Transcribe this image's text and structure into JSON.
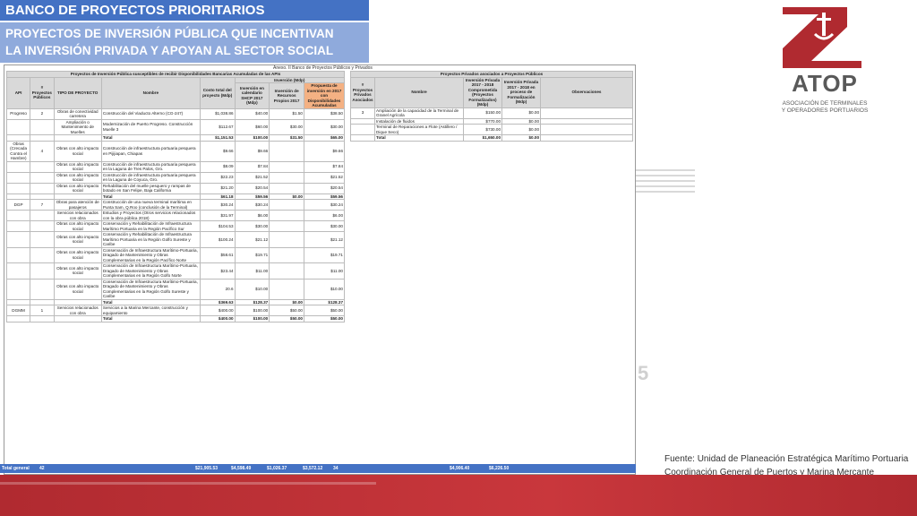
{
  "header": {
    "title": "BANCO DE PROYECTOS PRIORITARIOS",
    "subtitle_line1": "PROYECTOS DE INVERSIÓN PÚBLICA QUE INCENTIVAN",
    "subtitle_line2": "LA INVERSIÓN PRIVADA Y APOYAN AL SECTOR SOCIAL"
  },
  "logo": {
    "brand": "ATOP",
    "sub1": "ASOCIACIÓN DE TERMINALES",
    "sub2": "Y OPERADORES PORTUARIOS",
    "color": "#b02a30"
  },
  "table": {
    "caption": "Anexo. II Banco de Proyectos Públicos y Privados",
    "left_header": "Proyectos de Inversión Pública susceptibles de recibir Disponibilidades Bancarias Acumuladas de las APIs",
    "right_header": "Proyectos Privados asociados a Proyectos Públicos",
    "inversion_header": "Inversión (Mdp)",
    "cols_left": [
      "API",
      "# Proyectos Públicos",
      "TIPO DE PROYECTO",
      "Nombre",
      "Costo total del proyecto (Mdp)",
      "Inversión en calendario SHCP 2017 (Mdp)",
      "Inversión de Recursos Propios 2017",
      "Propuesta de inversión en 2017 con Disponibilidades Acumuladas"
    ],
    "cols_right": [
      "# Proyectos Privados Asociados",
      "Nombre",
      "Inversión Privada 2017 - 2018 Comprometida (Proyectos Formalizados) (Mdp)",
      "Inversión Privada 2017 - 2018 en proceso de Formalización (Mdp)",
      "Observaciones"
    ],
    "rows": [
      {
        "api": "Progreso",
        "n": "2",
        "tipo": "Obras de conectividad carretera",
        "nombre": "Construcción del Viaducto Alterno (CG-247)",
        "costo": "$1,038.86",
        "shcp": "$40.00",
        "propios": "$1.50",
        "prop": "$38.50"
      },
      {
        "api": "",
        "n": "",
        "tipo": "Ampliación o Mantenimiento de Muelles",
        "nombre": "Modernización de Puerto Progreso. Construcción Muelle 3",
        "costo": "$112.67",
        "shcp": "$60.00",
        "propios": "$30.00",
        "prop": "$30.00"
      },
      {
        "api": "",
        "n": "",
        "tipo": "",
        "nombre": "Total",
        "costo": "$1,151.53",
        "shcp": "$100.00",
        "propios": "$31.50",
        "prop": "$65.00",
        "total": true
      },
      {
        "api": "Obras (Crecada Contra el Hambre)",
        "n": "4",
        "tipo": "Obras con alto impacto social",
        "nombre": "Construcción de infraestructura portuaria pesquera en Pijijiapan, Chiapas",
        "costo": "$9.66",
        "shcp": "$9.66",
        "propios": "",
        "prop": "$9.66"
      },
      {
        "api": "",
        "n": "",
        "tipo": "Obras con alto impacto social",
        "nombre": "Construcción de infraestructura portuaria pesquera en la Laguna de Tres Palos, Gro.",
        "costo": "$8.09",
        "shcp": "$7.84",
        "propios": "",
        "prop": "$7.84"
      },
      {
        "api": "",
        "n": "",
        "tipo": "Obras con alto impacto social",
        "nombre": "Construcción de infraestructura portuaria pesquera en la Laguna de Coyuca, Gro.",
        "costo": "$22.23",
        "shcp": "$21.52",
        "propios": "",
        "prop": "$21.52"
      },
      {
        "api": "",
        "n": "",
        "tipo": "Obras con alto impacto social",
        "nombre": "Rehabilitación del muelle pesquero y rampas de botado en San Felipe, Baja California",
        "costo": "$21.20",
        "shcp": "$20.54",
        "propios": "",
        "prop": "$20.54"
      },
      {
        "api": "",
        "n": "",
        "tipo": "",
        "nombre": "Total",
        "costo": "$61.18",
        "shcp": "$59.56",
        "propios": "$0.00",
        "prop": "$59.56",
        "total": true
      },
      {
        "api": "DGP",
        "n": "7",
        "tipo": "Obras para atención de pasajeros",
        "nombre": "Construcción de una nueva terminal marítima en Punta Sam, Q.Roo (conclusión de la Terminal)",
        "costo": "$30.24",
        "shcp": "$30.24",
        "propios": "",
        "prop": "$30.24"
      },
      {
        "api": "",
        "n": "",
        "tipo": "Servicios relacionados con obra",
        "nombre": "Estudios y Proyectos (Otros servicios relacionados con la obra pública 2018)",
        "costo": "$31.97",
        "shcp": "$6.00",
        "propios": "",
        "prop": "$6.00"
      },
      {
        "api": "",
        "n": "",
        "tipo": "Obras con alto impacto social",
        "nombre": "Conservación y Rehabilitación de Infraestructura Marítimo Portuaria en la Región Pacífico Sur",
        "costo": "$104.53",
        "shcp": "$30.00",
        "propios": "",
        "prop": "$30.00"
      },
      {
        "api": "",
        "n": "",
        "tipo": "Obras con alto impacto social",
        "nombre": "Conservación y Rehabilitación de Infraestructura Marítimo Portuaria en la Región Golfo Sureste y Caribe",
        "costo": "$100.24",
        "shcp": "$21.12",
        "propios": "",
        "prop": "$21.12"
      },
      {
        "api": "",
        "n": "",
        "tipo": "Obras con alto impacto social",
        "nombre": "Conservación de Infraestructura Marítimo-Portuaria, Dragado de Mantenimiento y Obras Complementarias en la Región Pacífico Norte",
        "costo": "$58.61",
        "shcp": "$19.71",
        "propios": "",
        "prop": "$19.71"
      },
      {
        "api": "",
        "n": "",
        "tipo": "Obras con alto impacto social",
        "nombre": "Conservación de Infraestructura Marítimo-Portuaria, Dragado de Mantenimiento y Obras Complementarias en la Región Golfo Norte",
        "costo": "$23.44",
        "shcp": "$11.00",
        "propios": "",
        "prop": "$11.00"
      },
      {
        "api": "",
        "n": "",
        "tipo": "Obras con alto impacto social",
        "nombre": "Conservación de Infraestructura Marítimo-Portuaria, Dragado de Mantenimiento y Obras Complementarias en la Región Golfo Sureste y Caribe",
        "costo": "20.6",
        "shcp": "$10.00",
        "propios": "",
        "prop": "$10.00"
      },
      {
        "api": "",
        "n": "",
        "tipo": "",
        "nombre": "Total",
        "costo": "$369.63",
        "shcp": "$128.37",
        "propios": "$0.00",
        "prop": "$128.37",
        "total": true
      },
      {
        "api": "DGMM",
        "n": "1",
        "tipo": "Servicios relacionados con obra",
        "nombre": "Servicios a la Marina Mercante, construcción y equipamiento",
        "costo": "$400.00",
        "shcp": "$100.00",
        "propios": "$50.00",
        "prop": "$50.00"
      },
      {
        "api": "",
        "n": "",
        "tipo": "",
        "nombre": "Total",
        "costo": "$400.00",
        "shcp": "$100.00",
        "propios": "$50.00",
        "prop": "$50.00",
        "total": true
      }
    ],
    "private_rows": [
      {
        "n": "3",
        "nombre": "Ampliación de la capacidad de la Terminal de Granel Agrícola",
        "comp": "$150.00",
        "proc": "$0.00"
      },
      {
        "n": "",
        "nombre": "Instalación de fluidos",
        "comp": "$770.00",
        "proc": "$0.00"
      },
      {
        "n": "",
        "nombre": "Terminal de Reparaciones a Flote (Astillero / Dique Seco)",
        "comp": "$730.00",
        "proc": "$0.00"
      },
      {
        "n": "",
        "nombre": "Total",
        "comp": "$1,650.00",
        "proc": "$0.00",
        "total": true
      }
    ],
    "grand_total": {
      "label": "Total general",
      "n": "42",
      "costo": "$21,905.53",
      "shcp": "$4,598.49",
      "propios": "$1,026.37",
      "prop": "$3,572.12",
      "priv_n": "34",
      "comp": "$4,906.40",
      "proc": "$6,226.50"
    }
  },
  "page_number": "5",
  "source": {
    "line1": "Fuente: Unidad de Planeación Estratégica Marítimo Portuaria",
    "line2": "Coordinación General de Puertos y Marina Mercante"
  }
}
